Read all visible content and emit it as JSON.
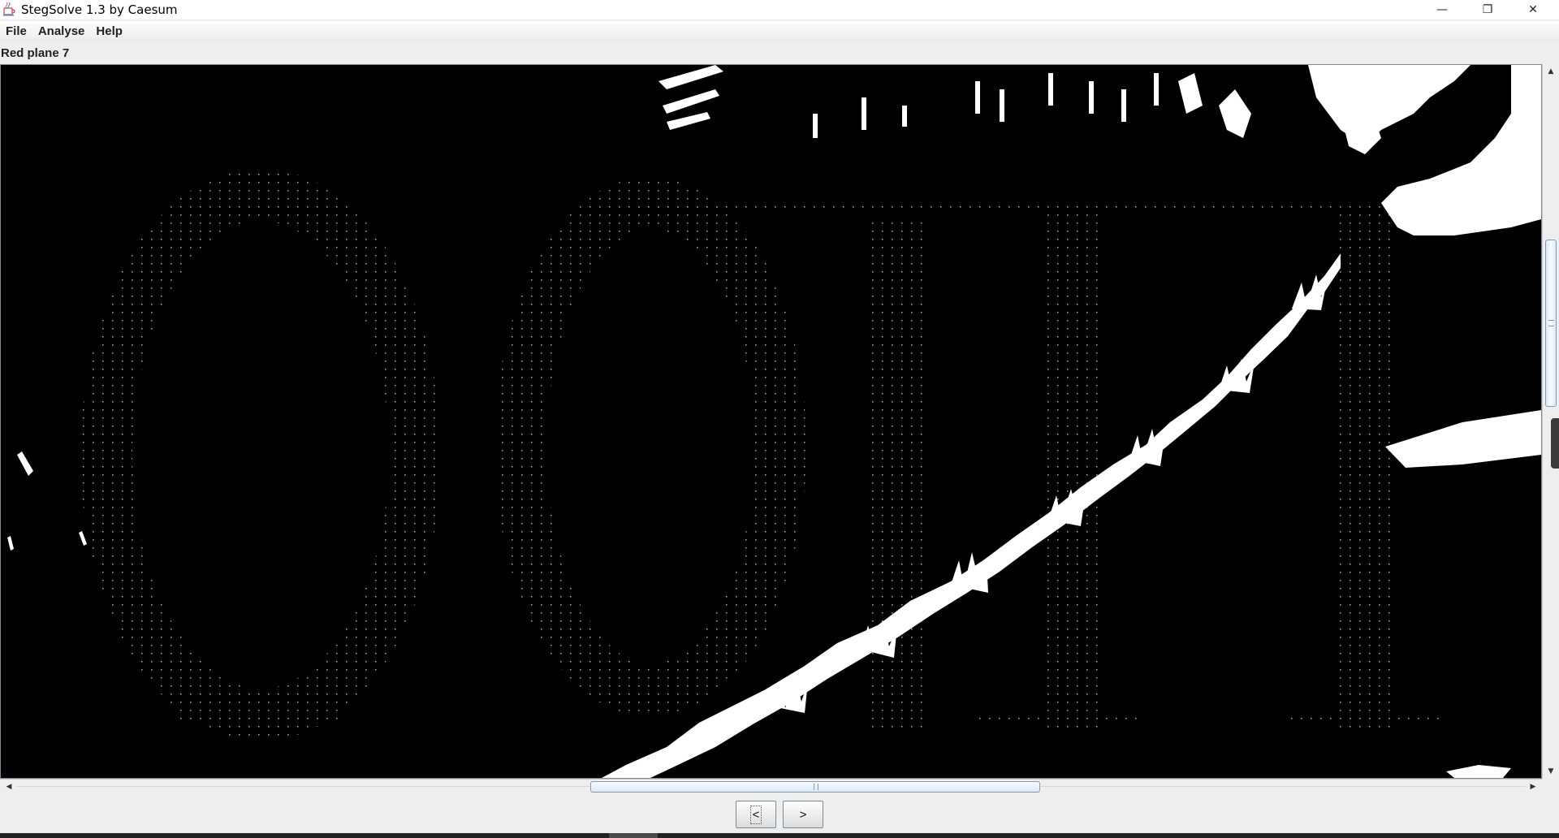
{
  "window": {
    "title": "StegSolve 1.3 by Caesum",
    "controls": {
      "minimize": "—",
      "restore": "❐",
      "close": "✕"
    }
  },
  "menu": {
    "items": [
      {
        "label": "File"
      },
      {
        "label": "Analyse"
      },
      {
        "label": "Help"
      }
    ]
  },
  "viewer": {
    "plane_label": "Red plane 7"
  },
  "navigation": {
    "prev_label": "<",
    "next_label": ">"
  },
  "icons": {
    "app": "java-cup-icon",
    "scroll_up": "▲",
    "scroll_down": "▼",
    "scroll_left": "◀",
    "scroll_right": "▶"
  },
  "colors": {
    "image_background": "#000000",
    "image_foreground": "#ffffff",
    "accent": "#7f9db9"
  }
}
